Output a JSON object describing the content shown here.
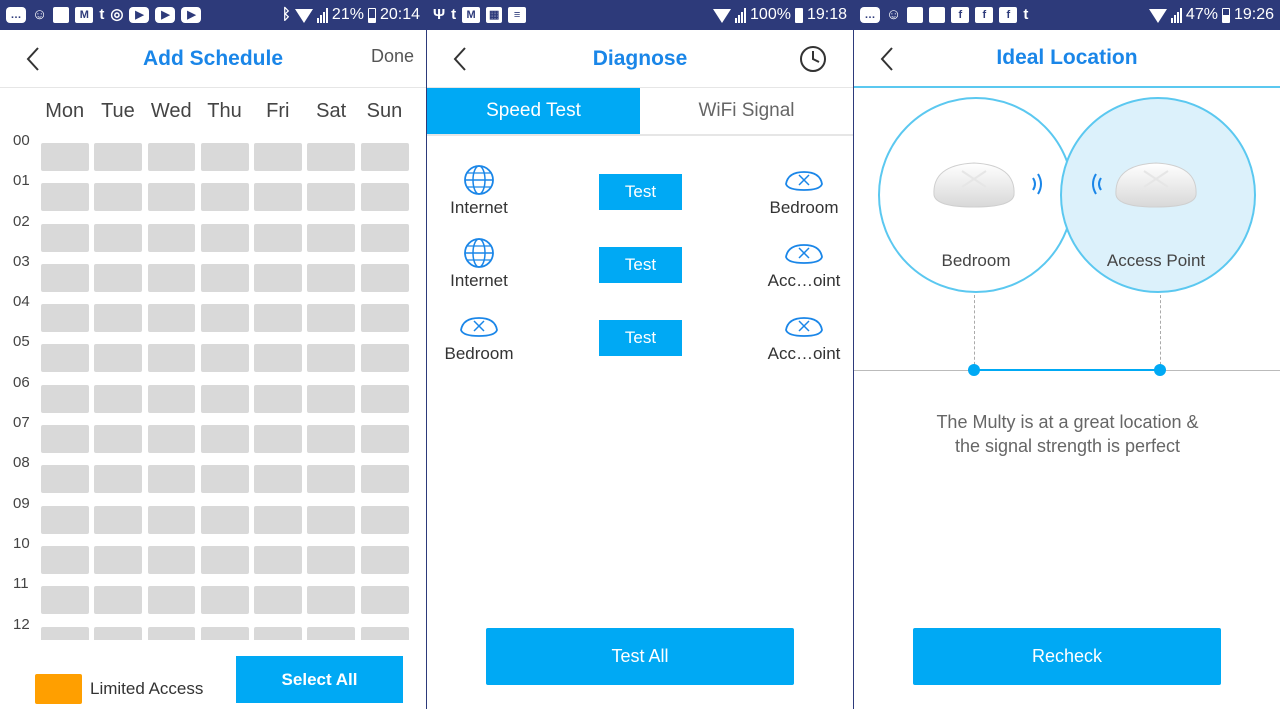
{
  "screen1": {
    "status": {
      "battery": "21%",
      "time": "20:14"
    },
    "title": "Add Schedule",
    "done": "Done",
    "days": [
      "Mon",
      "Tue",
      "Wed",
      "Thu",
      "Fri",
      "Sat",
      "Sun"
    ],
    "hours": [
      "00",
      "01",
      "02",
      "03",
      "04",
      "05",
      "06",
      "07",
      "08",
      "09",
      "10",
      "11",
      "12"
    ],
    "legend": "Limited Access",
    "select_all": "Select All"
  },
  "screen2": {
    "status": {
      "battery": "100%",
      "time": "19:18"
    },
    "title": "Diagnose",
    "tabs": [
      "Speed Test",
      "WiFi Signal"
    ],
    "rows": [
      {
        "left": "Internet",
        "right": "Bedroom",
        "button": "Test"
      },
      {
        "left": "Internet",
        "right": "Acc…oint",
        "button": "Test"
      },
      {
        "left": "Bedroom",
        "right": "Acc…oint",
        "button": "Test"
      }
    ],
    "test_all": "Test All"
  },
  "screen3": {
    "status": {
      "battery": "47%",
      "time": "19:26"
    },
    "title": "Ideal Location",
    "left_device": "Bedroom",
    "right_device": "Access Point",
    "message_line1": "The Multy is at a great location &",
    "message_line2": "the signal strength is perfect",
    "recheck": "Recheck"
  },
  "colors": {
    "accent": "#00a9f4",
    "title": "#1a86e8",
    "statusbar": "#2d3a7a",
    "legend": "#ff9f00",
    "cell": "#d9d9d9"
  }
}
